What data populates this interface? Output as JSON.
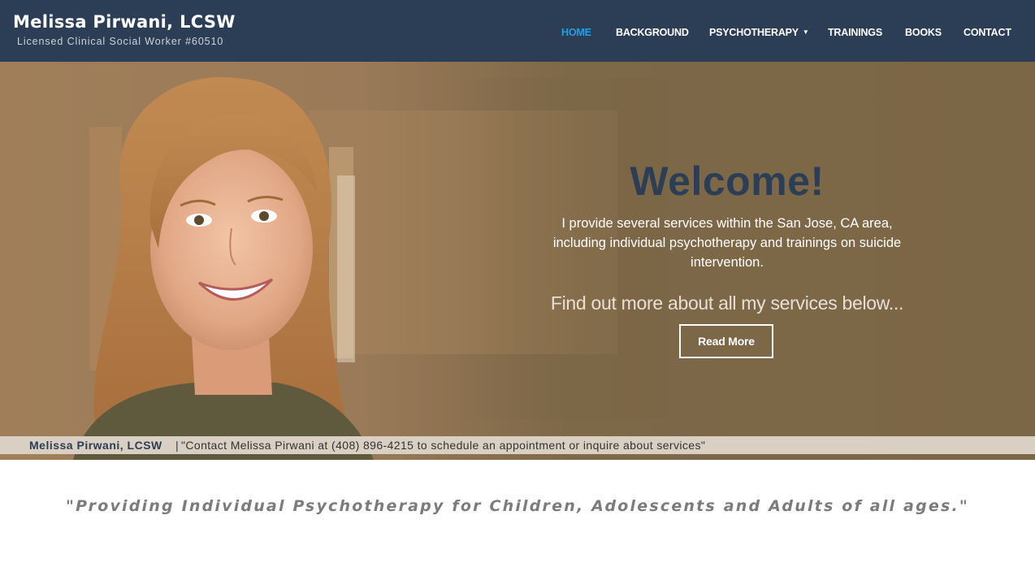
{
  "header": {
    "brand_name": "Melissa Pirwani, LCSW",
    "brand_subtitle": "Licensed Clinical Social Worker #60510",
    "nav": [
      {
        "label": "HOME",
        "active": true
      },
      {
        "label": "BACKGROUND",
        "active": false
      },
      {
        "label": "PSYCHOTHERAPY",
        "active": false,
        "dropdown": true
      },
      {
        "label": "TRAININGS",
        "active": false
      },
      {
        "label": "BOOKS",
        "active": false
      },
      {
        "label": "CONTACT",
        "active": false
      }
    ]
  },
  "hero": {
    "heading": "Welcome!",
    "intro": "I provide several services within the San Jose, CA area, including individual psychotherapy and trainings on suicide intervention.",
    "find_more": "Find out more about all my services below...",
    "button_label": "Read More"
  },
  "contact_strip": {
    "name": "Melissa Pirwani, LCSW",
    "separator": "|",
    "message": "\"Contact Melissa Pirwani at (408) 896-4215 to schedule an appointment or inquire about services\""
  },
  "tagline": "\"Providing Individual Psychotherapy for Children, Adolescents and Adults of all ages.\"",
  "colors": {
    "navbar": "#2c3e55",
    "active_nav": "#1da1e8",
    "hero_bg": "#7b6646",
    "strip_bg": "#d9cfc2",
    "tagline": "#7c7c7c"
  },
  "icons": {
    "dropdown_caret": "caret-down-icon"
  }
}
